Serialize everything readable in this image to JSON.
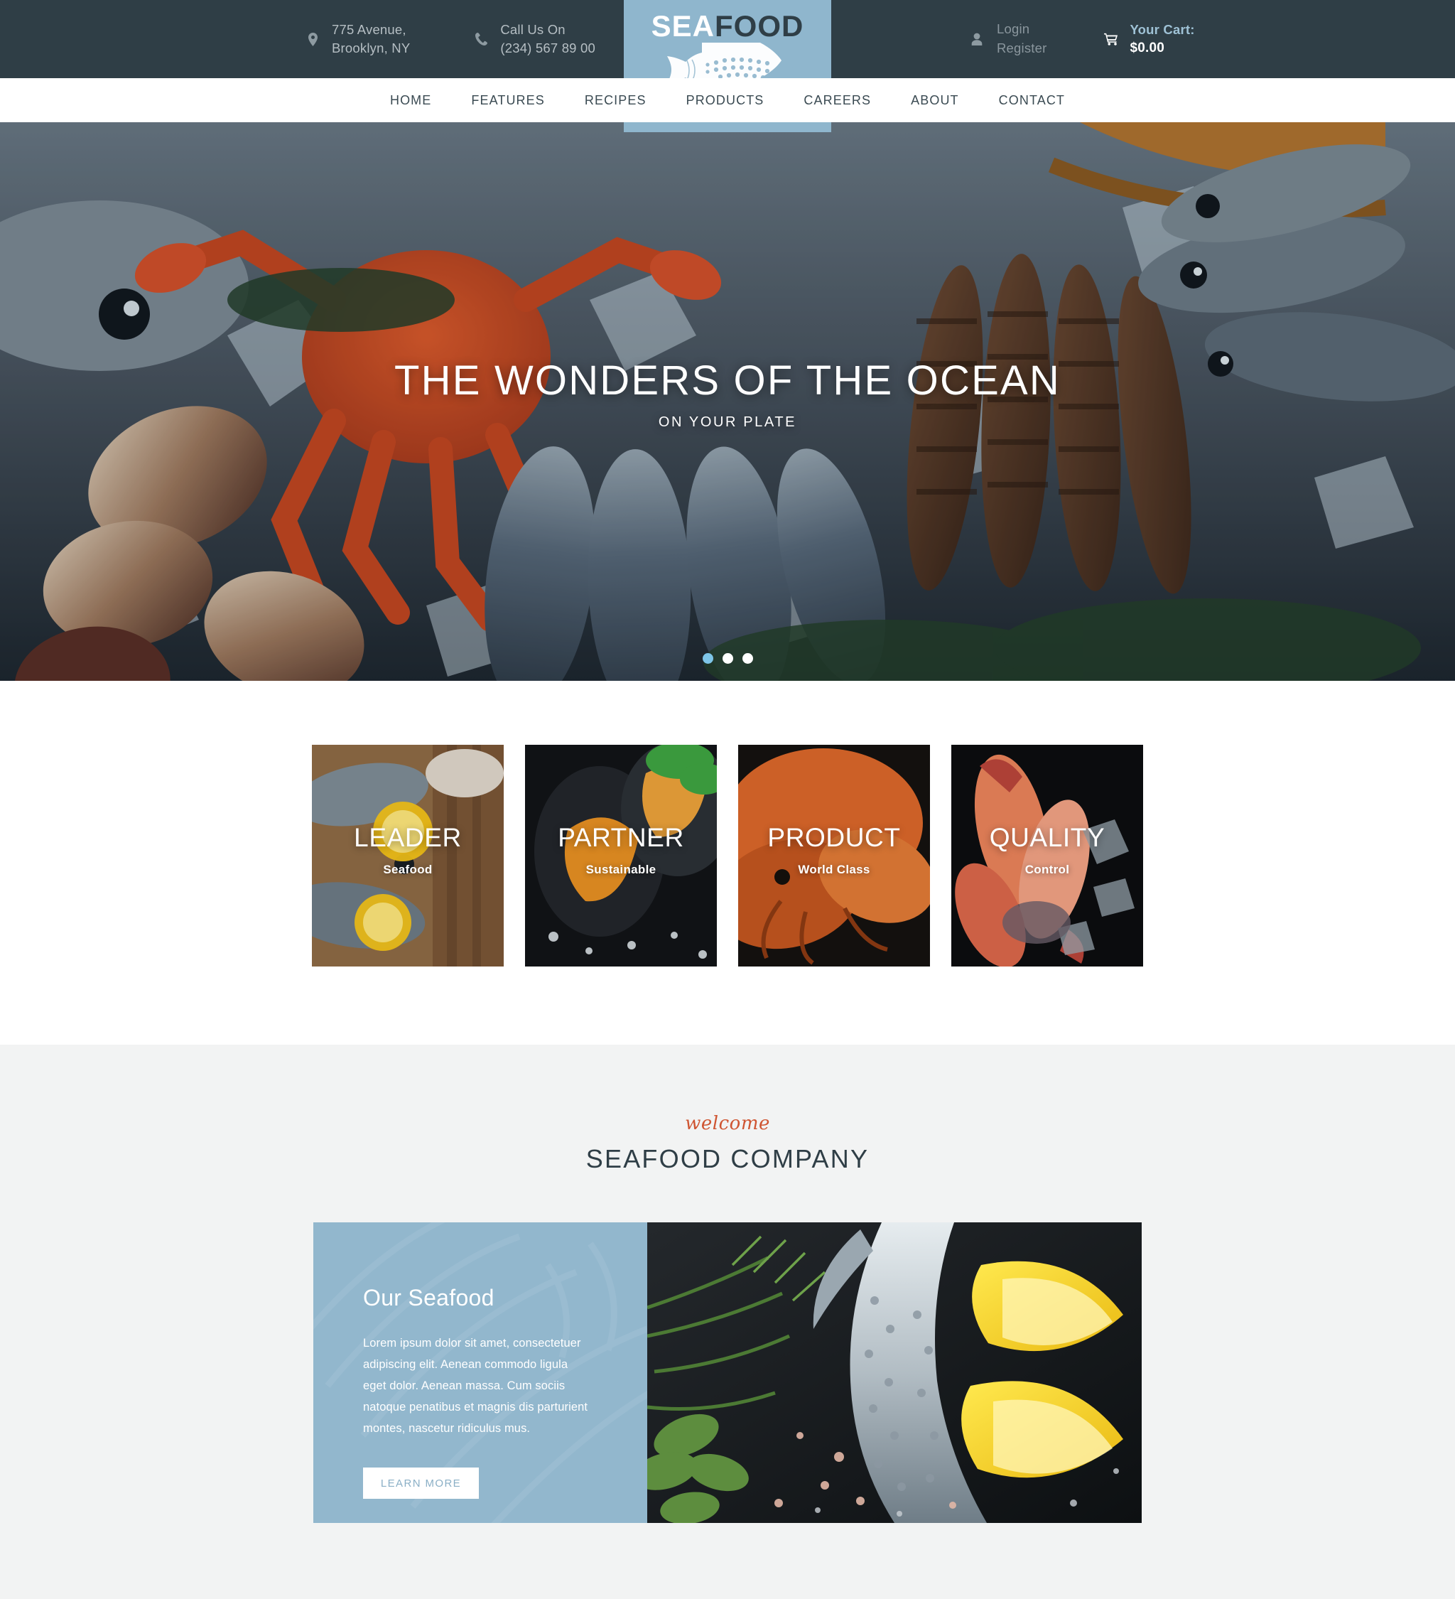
{
  "topbar": {
    "address": {
      "icon": "location-pin-icon",
      "line1": "775 Avenue,",
      "line2": "Brooklyn, NY"
    },
    "phone": {
      "icon": "phone-icon",
      "line1": "Call Us On",
      "line2": "(234) 567 89 00"
    },
    "account": {
      "icon": "user-icon",
      "login": "Login",
      "register": "Register"
    },
    "cart": {
      "icon": "cart-icon",
      "label": "Your Cart:",
      "total": "$0.00"
    }
  },
  "logo": {
    "part1": "SEA",
    "part2": "FOOD",
    "icon": "fish-icon",
    "bg": "#8fb6cd"
  },
  "nav": {
    "items": [
      {
        "label": "HOME"
      },
      {
        "label": "FEATURES"
      },
      {
        "label": "RECIPES"
      },
      {
        "label": "PRODUCTS"
      },
      {
        "label": "CAREERS"
      },
      {
        "label": "ABOUT"
      },
      {
        "label": "CONTACT"
      }
    ]
  },
  "hero": {
    "title": "THE WONDERS OF THE OCEAN",
    "subtitle": "ON YOUR PLATE",
    "slides": [
      {
        "active": true
      },
      {
        "active": false
      },
      {
        "active": false
      }
    ],
    "active_dot_color": "#7ec5e8"
  },
  "cards": [
    {
      "title": "LEADER",
      "subtitle": "Seafood"
    },
    {
      "title": "PARTNER",
      "subtitle": "Sustainable"
    },
    {
      "title": "PRODUCT",
      "subtitle": "World Class"
    },
    {
      "title": "QUALITY",
      "subtitle": "Control"
    }
  ],
  "welcome": {
    "script": "welcome",
    "script_color": "#cf5532",
    "title": "SEAFOOD COMPANY"
  },
  "about": {
    "heading": "Our Seafood",
    "body": "Lorem ipsum dolor sit amet, consectetuer adipiscing elit. Aenean commodo ligula eget dolor. Aenean massa. Cum sociis natoque penatibus et magnis dis parturient montes, nascetur ridiculus mus.",
    "button_label": "LEARN MORE",
    "panel_bg": "#92b7cd"
  }
}
